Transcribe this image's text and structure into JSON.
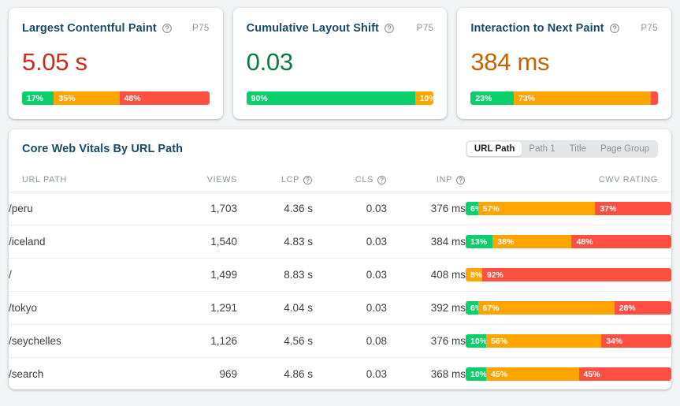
{
  "metric_cards": [
    {
      "title": "Largest Contentful Paint",
      "help_icon": "help-circle-icon",
      "percentile_label": "P75",
      "value": "5.05 s",
      "value_color": "#cf2b1d",
      "value_tone": "red",
      "distribution": [
        {
          "label": "17%",
          "pct": 17,
          "rating": "good",
          "color": "#0cce6b"
        },
        {
          "label": "35%",
          "pct": 35,
          "rating": "needs-improvement",
          "color": "#ffa400"
        },
        {
          "label": "48%",
          "pct": 48,
          "rating": "poor",
          "color": "#ff4e42"
        }
      ]
    },
    {
      "title": "Cumulative Layout Shift",
      "help_icon": "help-circle-icon",
      "percentile_label": "P75",
      "value": "0.03",
      "value_color": "#0a7b41",
      "value_tone": "green",
      "distribution": [
        {
          "label": "90%",
          "pct": 90,
          "rating": "good",
          "color": "#0cce6b"
        },
        {
          "label": "10%",
          "pct": 10,
          "rating": "needs-improvement",
          "color": "#ffa400"
        }
      ]
    },
    {
      "title": "Interaction to Next Paint",
      "help_icon": "help-circle-icon",
      "percentile_label": "P75",
      "value": "384 ms",
      "value_color": "#c46400",
      "value_tone": "amber",
      "distribution": [
        {
          "label": "23%",
          "pct": 23,
          "rating": "good",
          "color": "#0cce6b"
        },
        {
          "label": "73%",
          "pct": 73,
          "rating": "needs-improvement",
          "color": "#ffa400"
        },
        {
          "label": "",
          "pct": 4,
          "rating": "poor",
          "color": "#ff4e42"
        }
      ]
    }
  ],
  "table": {
    "title": "Core Web Vitals By URL Path",
    "grouping_tabs": [
      {
        "label": "URL Path",
        "active": true
      },
      {
        "label": "Path 1",
        "active": false
      },
      {
        "label": "Title",
        "active": false
      },
      {
        "label": "Page Group",
        "active": false
      }
    ],
    "columns": [
      {
        "key": "url_path",
        "label": "URL PATH",
        "align": "left",
        "help": false
      },
      {
        "key": "views",
        "label": "VIEWS",
        "align": "right",
        "help": false
      },
      {
        "key": "lcp",
        "label": "LCP",
        "align": "right",
        "help": true
      },
      {
        "key": "cls",
        "label": "CLS",
        "align": "right",
        "help": true
      },
      {
        "key": "inp",
        "label": "INP",
        "align": "right",
        "help": true
      },
      {
        "key": "cwv_rating",
        "label": "CWV RATING",
        "align": "right",
        "help": false
      }
    ],
    "rows": [
      {
        "url_path": "/peru",
        "views": "1,703",
        "lcp": "4.36 s",
        "lcp_tone": "red",
        "cls": "0.03",
        "cls_tone": "green",
        "inp": "376 ms",
        "inp_tone": "amber",
        "distribution": [
          {
            "label": "6%",
            "pct": 6,
            "rating": "good",
            "color": "#0cce6b"
          },
          {
            "label": "57%",
            "pct": 57,
            "rating": "needs-improvement",
            "color": "#ffa400"
          },
          {
            "label": "37%",
            "pct": 37,
            "rating": "poor",
            "color": "#ff4e42"
          }
        ]
      },
      {
        "url_path": "/iceland",
        "views": "1,540",
        "lcp": "4.83 s",
        "lcp_tone": "red",
        "cls": "0.03",
        "cls_tone": "green",
        "inp": "384 ms",
        "inp_tone": "amber",
        "distribution": [
          {
            "label": "13%",
            "pct": 13,
            "rating": "good",
            "color": "#0cce6b"
          },
          {
            "label": "38%",
            "pct": 38,
            "rating": "needs-improvement",
            "color": "#ffa400"
          },
          {
            "label": "48%",
            "pct": 48,
            "rating": "poor",
            "color": "#ff4e42"
          }
        ]
      },
      {
        "url_path": "/",
        "views": "1,499",
        "lcp": "8.83 s",
        "lcp_tone": "red",
        "cls": "0.03",
        "cls_tone": "green",
        "inp": "408 ms",
        "inp_tone": "amber",
        "distribution": [
          {
            "label": "8%",
            "pct": 8,
            "rating": "needs-improvement",
            "color": "#ffa400"
          },
          {
            "label": "92%",
            "pct": 92,
            "rating": "poor",
            "color": "#ff4e42"
          }
        ]
      },
      {
        "url_path": "/tokyo",
        "views": "1,291",
        "lcp": "4.04 s",
        "lcp_tone": "red",
        "cls": "0.03",
        "cls_tone": "green",
        "inp": "392 ms",
        "inp_tone": "amber",
        "distribution": [
          {
            "label": "6%",
            "pct": 6,
            "rating": "good",
            "color": "#0cce6b"
          },
          {
            "label": "67%",
            "pct": 67,
            "rating": "needs-improvement",
            "color": "#ffa400"
          },
          {
            "label": "28%",
            "pct": 28,
            "rating": "poor",
            "color": "#ff4e42"
          }
        ]
      },
      {
        "url_path": "/seychelles",
        "views": "1,126",
        "lcp": "4.56 s",
        "lcp_tone": "red",
        "cls": "0.08",
        "cls_tone": "green",
        "inp": "376 ms",
        "inp_tone": "amber",
        "distribution": [
          {
            "label": "10%",
            "pct": 10,
            "rating": "good",
            "color": "#0cce6b"
          },
          {
            "label": "56%",
            "pct": 56,
            "rating": "needs-improvement",
            "color": "#ffa400"
          },
          {
            "label": "34%",
            "pct": 34,
            "rating": "poor",
            "color": "#ff4e42"
          }
        ]
      },
      {
        "url_path": "/search",
        "views": "969",
        "lcp": "4.86 s",
        "lcp_tone": "red",
        "cls": "0.03",
        "cls_tone": "green",
        "inp": "368 ms",
        "inp_tone": "amber",
        "distribution": [
          {
            "label": "10%",
            "pct": 10,
            "rating": "good",
            "color": "#0cce6b"
          },
          {
            "label": "45%",
            "pct": 45,
            "rating": "needs-improvement",
            "color": "#ffa400"
          },
          {
            "label": "45%",
            "pct": 45,
            "rating": "poor",
            "color": "#ff4e42"
          }
        ]
      }
    ]
  },
  "theme": {
    "page_background": "#f1f3f4",
    "card_background": "#ffffff",
    "heading_color": "#184a6b",
    "muted_text": "#8a949c",
    "good": "#0cce6b",
    "needs_improvement": "#ffa400",
    "poor": "#ff4e42"
  }
}
